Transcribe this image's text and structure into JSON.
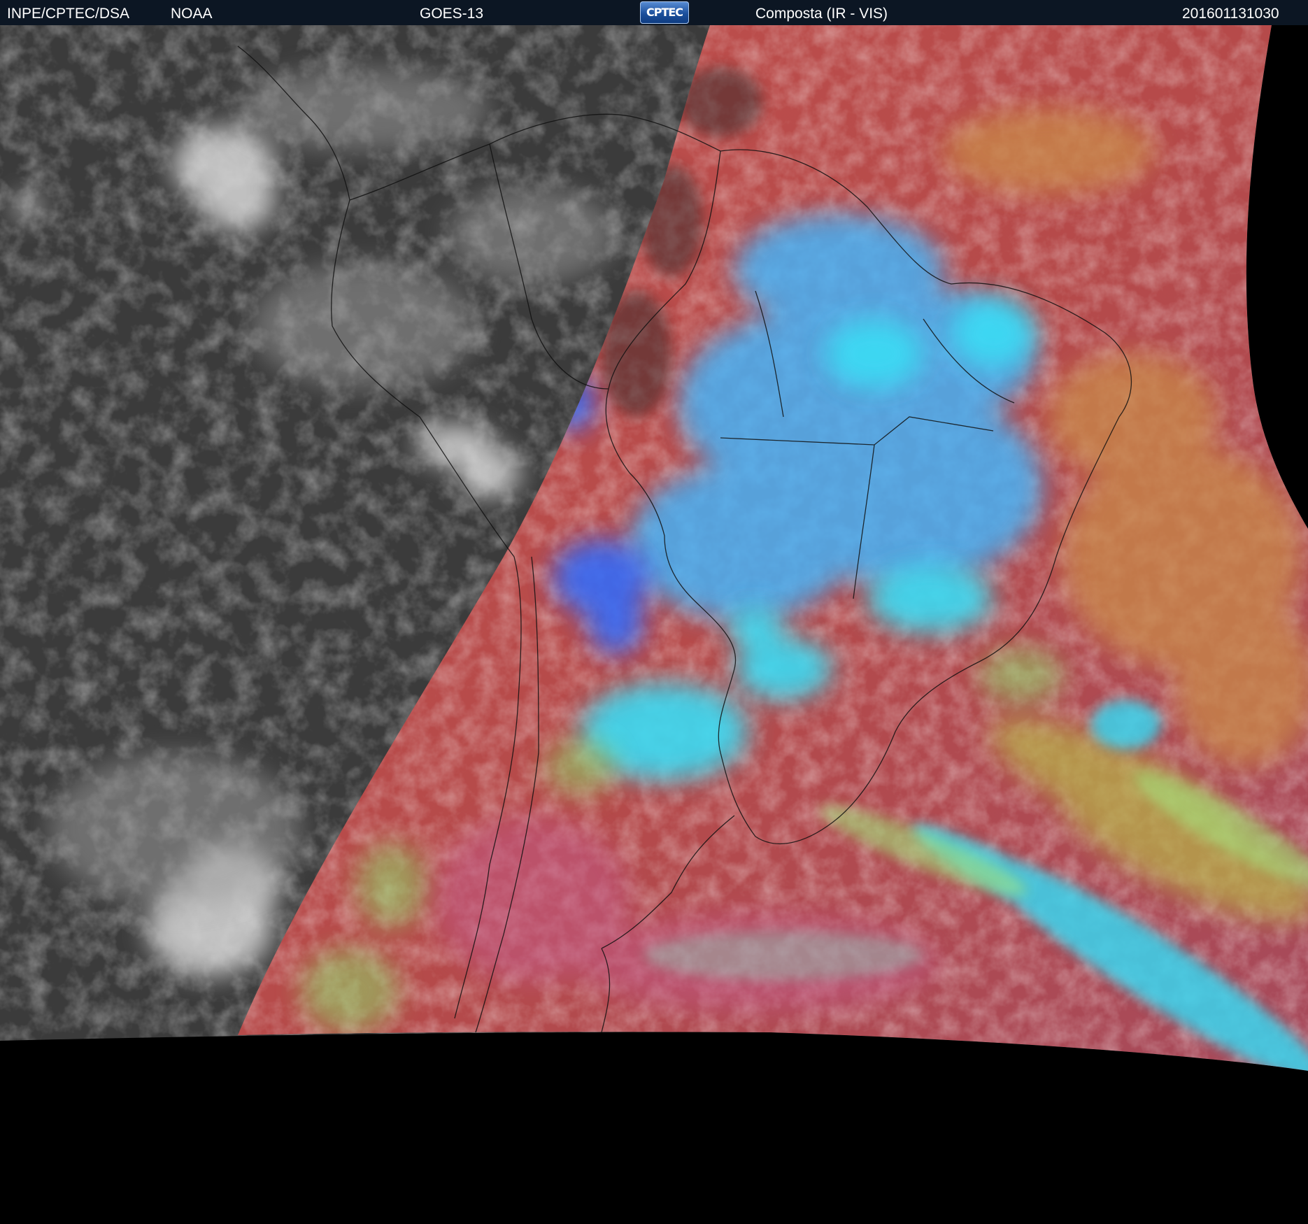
{
  "header": {
    "agency": "INPE/CPTEC/DSA",
    "partner": "NOAA",
    "satellite": "GOES-13",
    "logo_text": "CPTEC",
    "product": "Composta (IR - VIS)",
    "timestamp": "201601131030"
  },
  "colors": {
    "header_bg": "#0c1623",
    "night_ir": "#3a3a3a",
    "day_composite_red": "#b84a48",
    "cloud_cyan": "#35d8f2",
    "cloud_blue": "#3a78ff",
    "cloud_green": "#9be06a",
    "space": "#000000"
  }
}
